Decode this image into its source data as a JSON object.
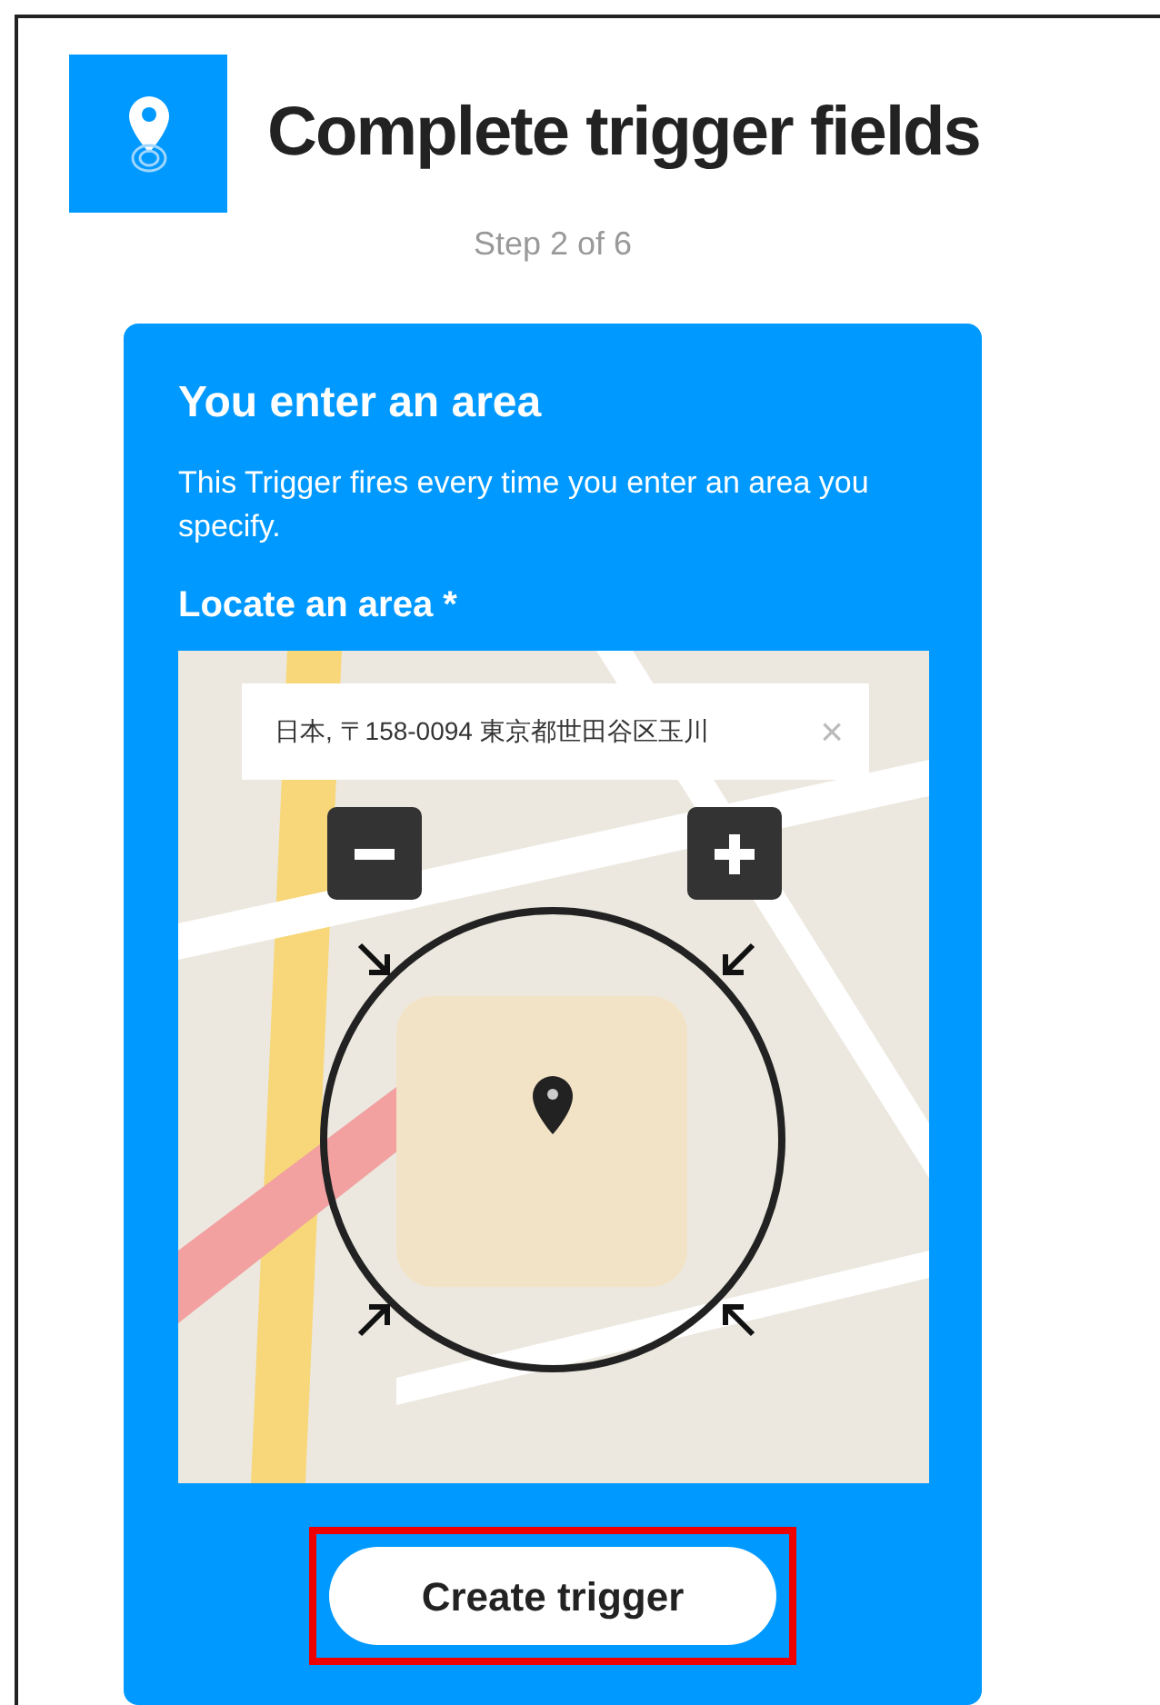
{
  "header": {
    "title": "Complete trigger fields",
    "step": "Step 2 of 6"
  },
  "card": {
    "title": "You enter an area",
    "description": "This Trigger fires every time you enter an area you specify.",
    "field_label": "Locate an area *",
    "map": {
      "search_value": "日本, 〒158-0094 東京都世田谷区玉川",
      "clear": "×"
    },
    "button": {
      "label": "Create trigger",
      "highlighted": true
    }
  }
}
